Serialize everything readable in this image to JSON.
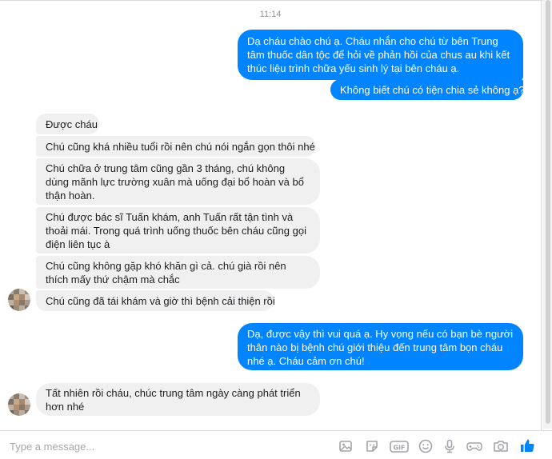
{
  "conversation": {
    "timestamp": "11:14",
    "messages": [
      {
        "sender": "me",
        "text": "Dạ cháu chào chú ạ. Cháu nhắn cho chú từ bên Trung tâm thuốc dân tộc để hỏi về phản hồi của chus au khi kết thúc liệu trình chữa yếu sinh lý tại bên cháu ạ."
      },
      {
        "sender": "me",
        "text": "Không biết chú có tiện chia sẻ không ạ?"
      },
      {
        "sender": "them",
        "text": "Được cháu"
      },
      {
        "sender": "them",
        "text": "Chú cũng khá nhiều tuổi rồi nên chú nói ngắn gọn thôi nhé"
      },
      {
        "sender": "them",
        "text": "Chú chữa ở trung tâm cũng gần 3 tháng, chú không dùng mãnh lực trường xuân mà uống đại bổ hoàn và bổ thận hoàn."
      },
      {
        "sender": "them",
        "text": "Chú được bác sĩ Tuấn khám, anh Tuấn rất tận tình và thoải mái. Trong quá trình uống thuốc bên cháu cũng gọi điện liên tục à"
      },
      {
        "sender": "them",
        "text": "Chú cũng không gặp khó khăn gì cả. chú già rồi nên thích mấy thứ chậm mà chắc"
      },
      {
        "sender": "them",
        "text": "Chú cũng đã tái khám và giờ thì bệnh cải thiện rồi"
      },
      {
        "sender": "me",
        "text": "Dạ, được vậy thì vui quá ạ. Hy vọng nếu có bạn bè người thân nào bị bệnh chú giới thiệu đến trung tâm bọn cháu nhé ạ. Cháu cảm ơn chú!"
      },
      {
        "sender": "them",
        "text": "Tất nhiên rồi cháu, chúc trung tâm ngày càng phát triển hơn nhé"
      }
    ]
  },
  "composer": {
    "placeholder": "Type a message...",
    "tools": [
      "image-icon",
      "sticker-icon",
      "gif-icon",
      "emoji-icon",
      "microphone-icon",
      "game-icon",
      "camera-icon",
      "thumbs-up-icon"
    ]
  },
  "colors": {
    "my_bubble": "#0084ff",
    "their_bubble": "#f1f0f0",
    "icon": "#a0a4ab",
    "like": "#0084ff"
  }
}
